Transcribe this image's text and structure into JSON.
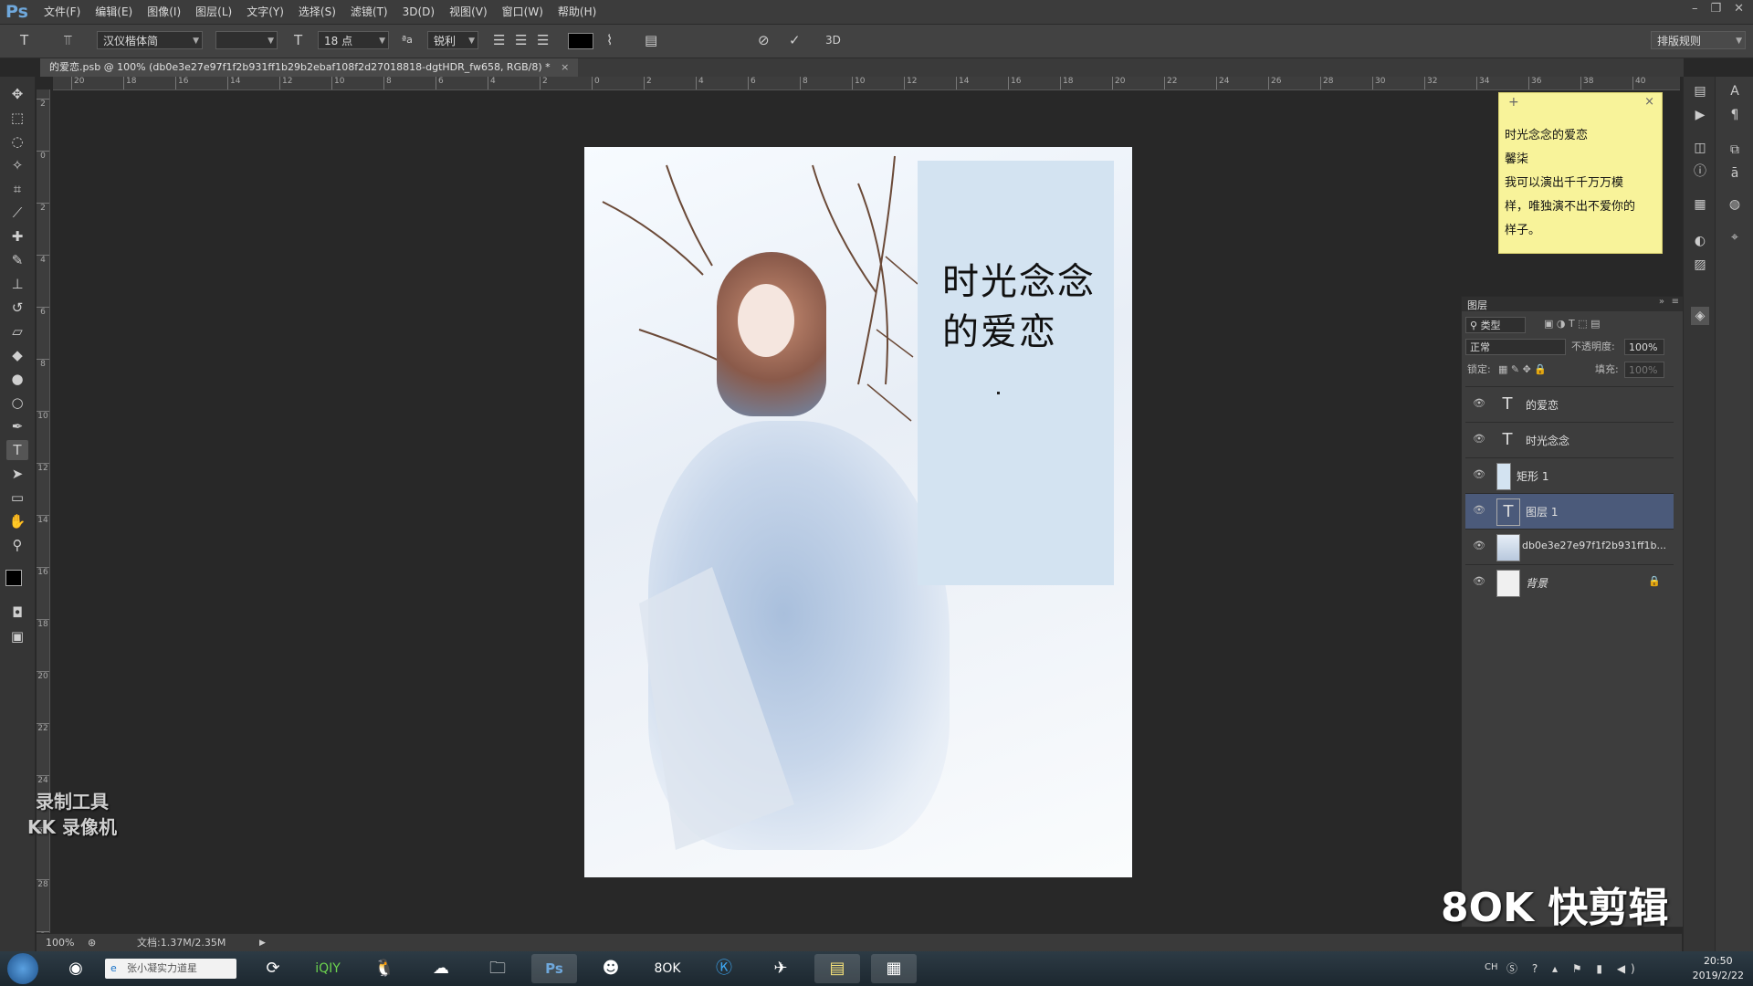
{
  "menubar": {
    "logo": "Ps",
    "items": [
      "文件(F)",
      "编辑(E)",
      "图像(I)",
      "图层(L)",
      "文字(Y)",
      "选择(S)",
      "滤镜(T)",
      "3D(D)",
      "视图(V)",
      "窗口(W)",
      "帮助(H)"
    ]
  },
  "options": {
    "font_family": "汉仪楷体简",
    "font_size": "18 点",
    "antialias": "锐利",
    "text_color": "#000000",
    "workspace": "排版规则",
    "cancel_icon": "cancel-icon",
    "commit_icon": "check-icon",
    "mode_3d": "3D"
  },
  "tab": {
    "title": "的爱恋.psb @ 100% (db0e3e27e97f1f2b931ff1b29b2ebaf108f2d27018818-dgtHDR_fw658, RGB/8) *",
    "close": "×"
  },
  "ruler": {
    "h_labels": [
      "20",
      "18",
      "16",
      "14",
      "12",
      "10",
      "8",
      "6",
      "4",
      "2",
      "0",
      "2",
      "4",
      "6",
      "8",
      "10",
      "12",
      "14",
      "16",
      "18",
      "20",
      "22",
      "24",
      "26",
      "28",
      "30",
      "32",
      "34",
      "36",
      "38",
      "40"
    ],
    "v_labels": [
      "2",
      "0",
      "2",
      "4",
      "6",
      "8",
      "10",
      "12",
      "14",
      "16",
      "18",
      "20",
      "22",
      "24",
      "26",
      "28",
      "3"
    ]
  },
  "canvas": {
    "title_line1": "时光念念",
    "title_line2": "的爱恋"
  },
  "note": {
    "plus": "+",
    "close": "×",
    "lines": [
      "时光念念的爱恋",
      "馨柒",
      "我可以演出千千万万模",
      "样，唯独演不出不爱你的",
      "样子。"
    ]
  },
  "layers_panel": {
    "title": "图层",
    "filter": "类型",
    "blend_mode": "正常",
    "opacity_label": "不透明度:",
    "opacity_value": "100%",
    "lock_label": "锁定:",
    "fill_label": "填充:",
    "fill_value": "100%",
    "layers": [
      {
        "name": "的爱恋",
        "kind": "text",
        "selected": false
      },
      {
        "name": "时光念念",
        "kind": "text",
        "selected": false
      },
      {
        "name": "矩形 1",
        "kind": "shape",
        "selected": false
      },
      {
        "name": "图层 1",
        "kind": "text",
        "selected": true
      },
      {
        "name": "db0e3e27e97f1f2b931ff1b...",
        "kind": "image",
        "selected": false
      },
      {
        "name": "背景",
        "kind": "background",
        "selected": false,
        "locked": true
      }
    ]
  },
  "status": {
    "zoom": "100%",
    "doc": "文档:1.37M/2.35M"
  },
  "watermark_left": {
    "line1": "录制工具",
    "line2": "KK 录像机"
  },
  "watermark_right": "8OK 快剪辑",
  "taskbar": {
    "search_text": "张小凝实力道星",
    "apps": [
      "360-icon",
      "browser-icon",
      "iqiyi-icon",
      "qq-icon",
      "baidu-cloud-icon",
      "explorer-icon",
      "photoshop-icon",
      "game-icon",
      "kuaijianji-icon",
      "k-icon",
      "paper-plane-icon",
      "sticky-notes-icon",
      "control-panel-icon"
    ],
    "tray_lang": "CH",
    "time": "20:50",
    "date": "2019/2/22"
  }
}
